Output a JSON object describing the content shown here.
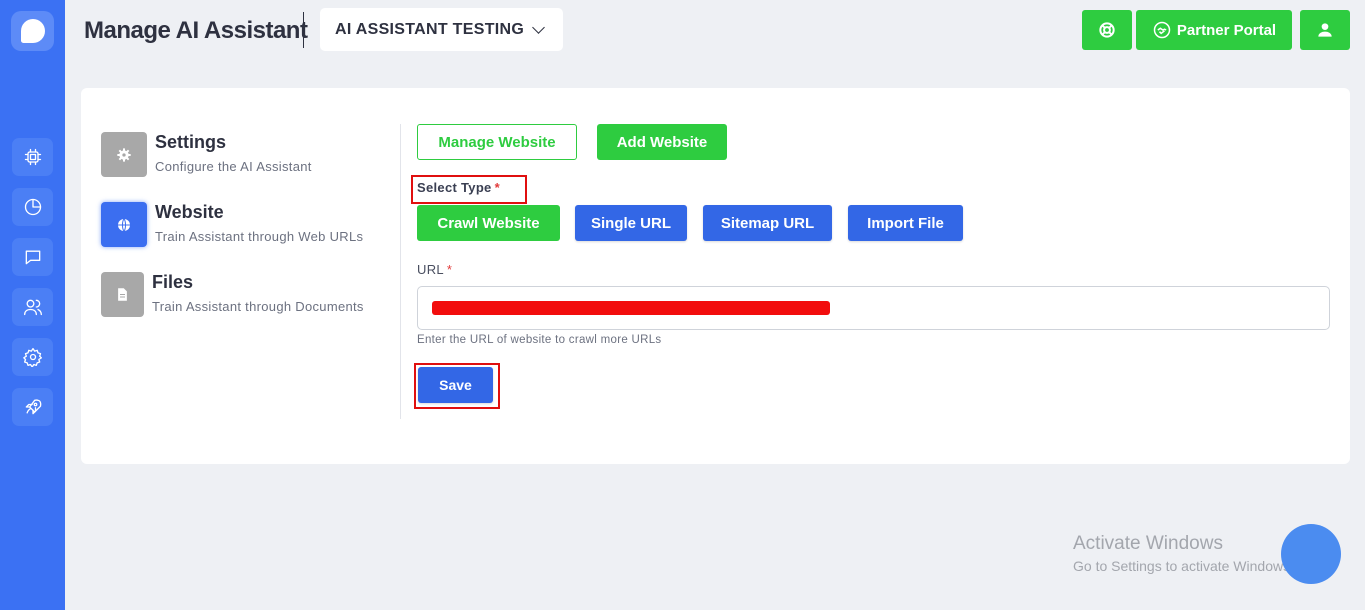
{
  "header": {
    "title": "Manage AI Assistant",
    "assistant_selector": "AI ASSISTANT TESTING",
    "support_icon": "lifebuoy-icon",
    "partner_portal_label": "Partner Portal",
    "partner_icon": "handshake-icon",
    "profile_icon": "user-icon"
  },
  "sidebar": {
    "logo_icon": "chat-bubble-icon",
    "items": [
      {
        "icon": "chip-icon"
      },
      {
        "icon": "pie-chart-icon"
      },
      {
        "icon": "message-icon"
      },
      {
        "icon": "users-icon"
      },
      {
        "icon": "gear-icon"
      },
      {
        "icon": "rocket-icon"
      }
    ]
  },
  "settings_menu": [
    {
      "title": "Settings",
      "subtitle": "Configure the AI Assistant",
      "icon": "gear-icon"
    },
    {
      "title": "Website",
      "subtitle": "Train Assistant through Web URLs",
      "icon": "globe-icon",
      "active": true
    },
    {
      "title": "Files",
      "subtitle": "Train Assistant through Documents",
      "icon": "document-icon"
    }
  ],
  "website_panel": {
    "manage_website_label": "Manage Website",
    "add_website_label": "Add Website",
    "select_type_label": "Select Type",
    "required_mark": "*",
    "type_options": [
      "Crawl Website",
      "Single URL",
      "Sitemap URL",
      "Import File"
    ],
    "selected_type": "Crawl Website",
    "url_label": "URL",
    "url_help": "Enter the URL of website to crawl more URLs",
    "save_label": "Save"
  },
  "watermark": {
    "title": "Activate Windows",
    "subtitle": "Go to Settings to activate Windows."
  },
  "colors": {
    "sidebar": "#3b71f3",
    "green": "#2ecc40",
    "blue": "#3367e6",
    "highlight": "#e00f0f",
    "redaction": "#f20d0d"
  }
}
